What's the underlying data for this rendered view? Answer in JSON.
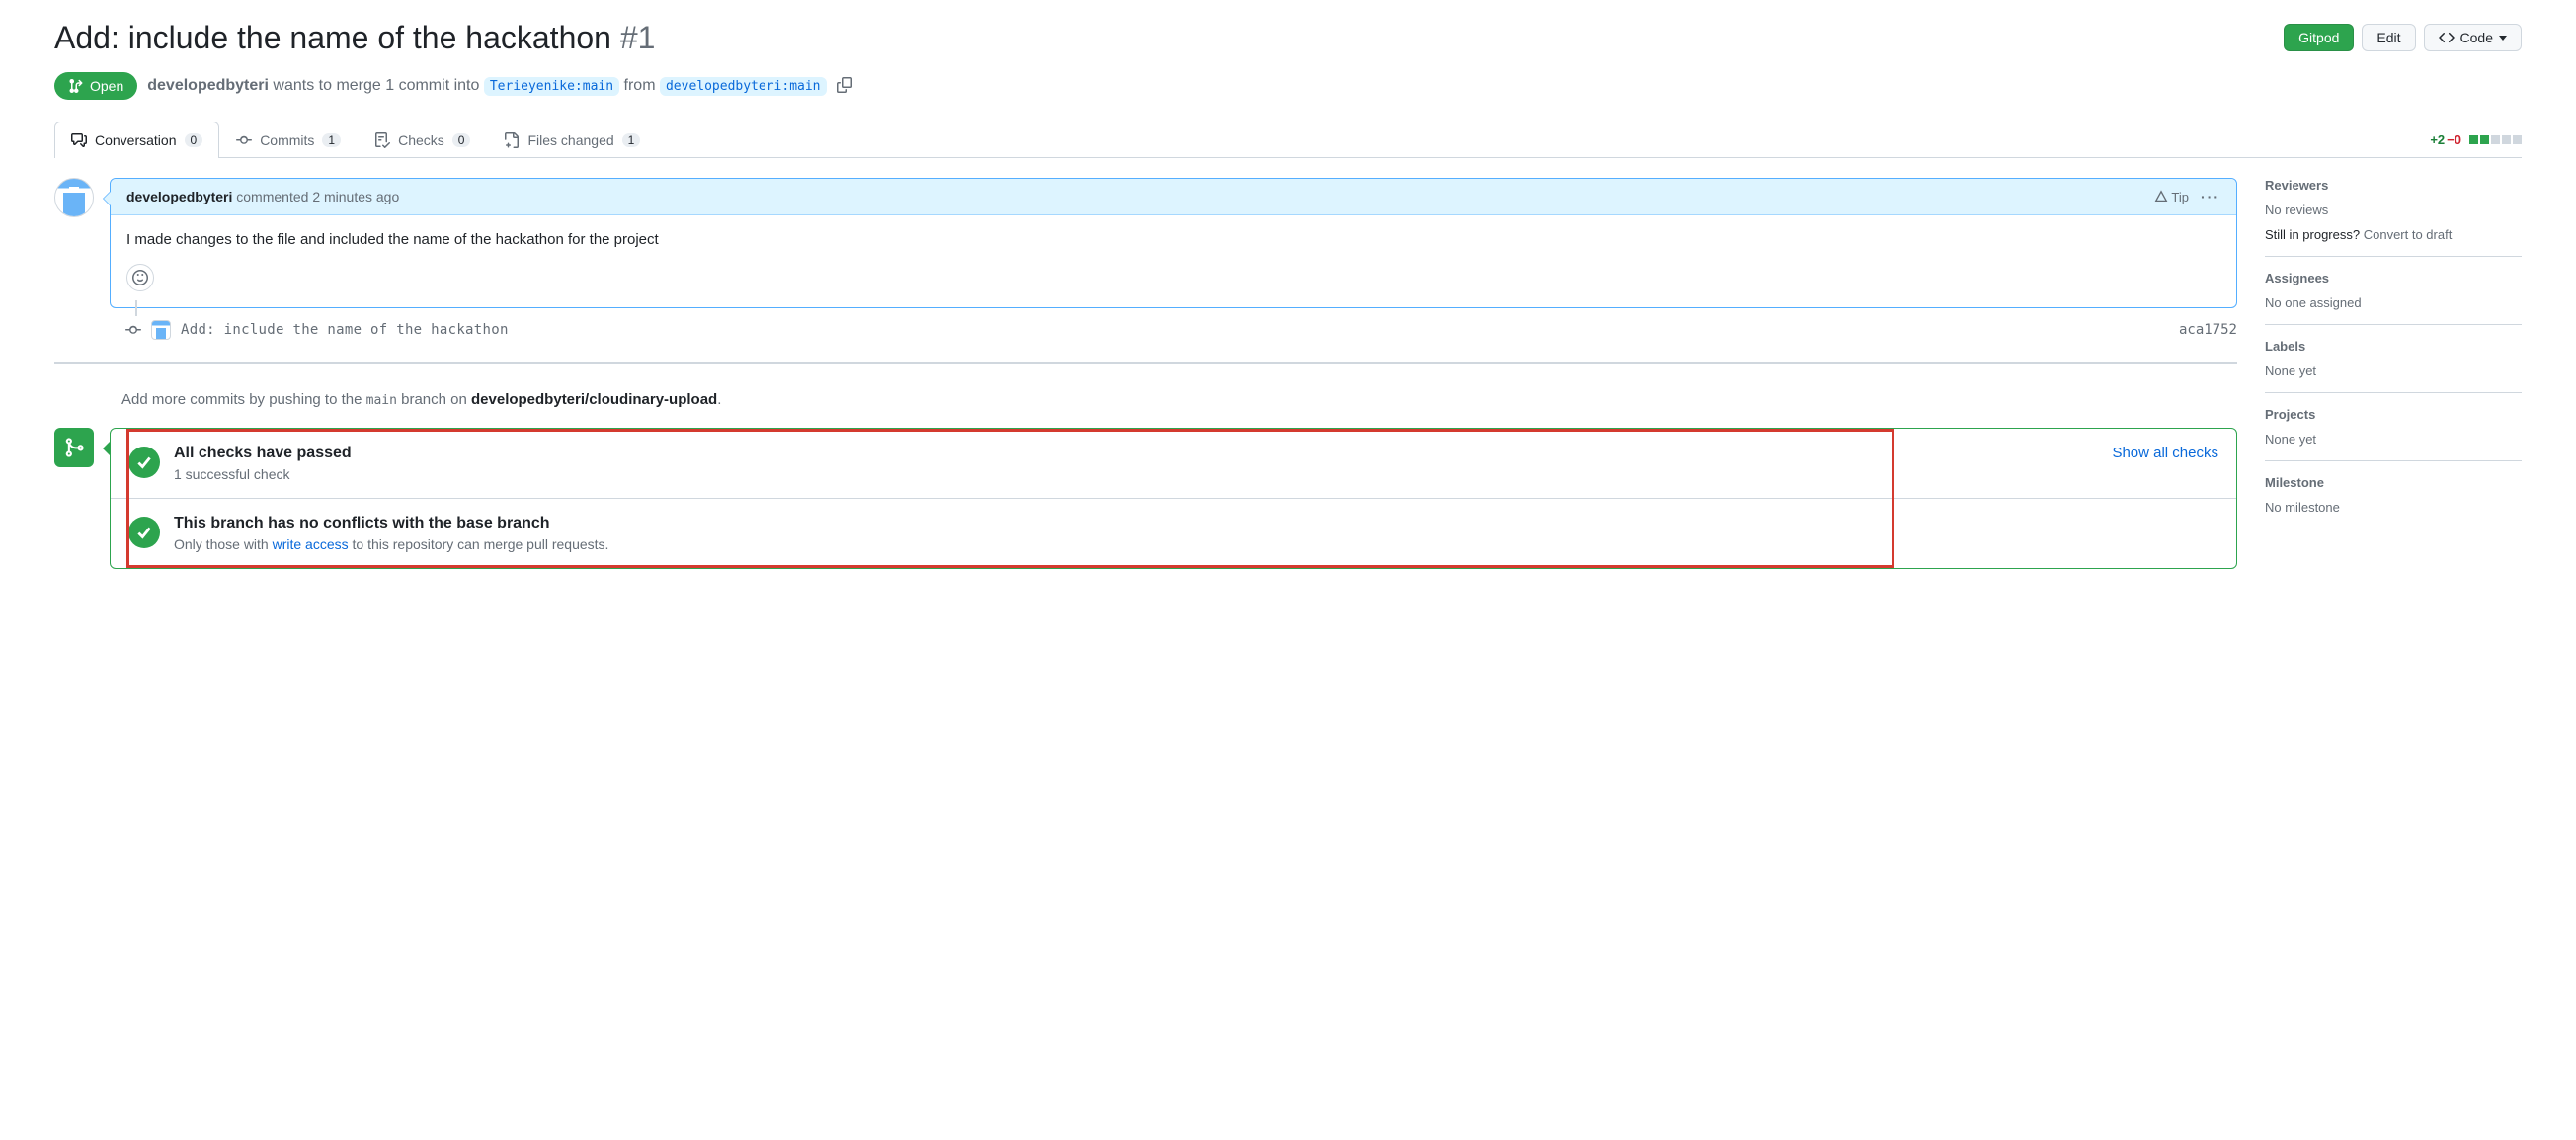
{
  "header": {
    "title": "Add: include the name of the hackathon",
    "issue_number": "#1",
    "gitpod": "Gitpod",
    "edit": "Edit",
    "code": "Code"
  },
  "meta": {
    "state": "Open",
    "author": "developedbyteri",
    "merge_text_1": "wants to merge 1 commit into",
    "base_branch": "Terieyenike:main",
    "from": "from",
    "head_branch": "developedbyteri:main"
  },
  "tabs": {
    "conversation": {
      "label": "Conversation",
      "count": "0"
    },
    "commits": {
      "label": "Commits",
      "count": "1"
    },
    "checks": {
      "label": "Checks",
      "count": "0"
    },
    "files": {
      "label": "Files changed",
      "count": "1"
    }
  },
  "diffstat": {
    "add": "+2",
    "del": "−0"
  },
  "comment": {
    "author": "developedbyteri",
    "action": " commented ",
    "time": "2 minutes ago",
    "tip": "Tip",
    "body": "I made changes to the file and included the name of the hackathon for the project"
  },
  "commit": {
    "message": "Add: include the name of the hackathon",
    "sha": "aca1752"
  },
  "push_hint": {
    "pre": "Add more commits by pushing to the ",
    "branch": "main",
    "mid": " branch on ",
    "repo": "developedbyteri/cloudinary-upload",
    "post": "."
  },
  "merge": {
    "checks_title": "All checks have passed",
    "checks_sub": "1 successful check",
    "show_all": "Show all checks",
    "conflicts_title": "This branch has no conflicts with the base branch",
    "conflicts_sub_pre": "Only those with ",
    "conflicts_link": "write access",
    "conflicts_sub_post": " to this repository can merge pull requests."
  },
  "sidebar": {
    "reviewers": {
      "title": "Reviewers",
      "no_reviews": "No reviews",
      "progress": "Still in progress? ",
      "draft": "Convert to draft"
    },
    "assignees": {
      "title": "Assignees",
      "none": "No one assigned"
    },
    "labels": {
      "title": "Labels",
      "none": "None yet"
    },
    "projects": {
      "title": "Projects",
      "none": "None yet"
    },
    "milestone": {
      "title": "Milestone",
      "none": "No milestone"
    }
  }
}
